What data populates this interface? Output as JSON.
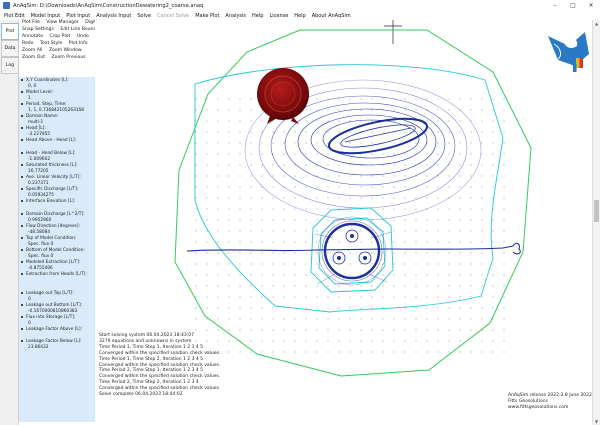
{
  "window": {
    "title": "AnAqSim: D:\\Downloads\\AnAqSim\\ConstructionDewatering2_coarse.anaq",
    "minimize": "–",
    "maximize": "□",
    "close": "✕"
  },
  "menu": [
    {
      "label": "Plot Edit",
      "enabled": true
    },
    {
      "label": "Model Input",
      "enabled": true
    },
    {
      "label": "Plot Input",
      "enabled": true
    },
    {
      "label": "Analysis Input",
      "enabled": true
    },
    {
      "label": "Solve",
      "enabled": true
    },
    {
      "label": "Cancel Solve",
      "enabled": false
    },
    {
      "label": "Make Plot",
      "enabled": true
    },
    {
      "label": "Analysis",
      "enabled": true
    },
    {
      "label": "Help",
      "enabled": true
    },
    {
      "label": "License",
      "enabled": true
    },
    {
      "label": "Help",
      "enabled": true
    },
    {
      "label": "About AnAqSim",
      "enabled": true
    }
  ],
  "side_tabs": {
    "plot": "Plot",
    "data": "Data",
    "log": "Log"
  },
  "commands": {
    "row1": [
      "Plot File",
      "View Manager",
      "Digitize"
    ],
    "row2": [
      "Snap Settings",
      "Edit Line Boundary"
    ],
    "row3": [
      "Annotate",
      "Crop Plot",
      "Undo"
    ],
    "row4": [
      "Redo",
      "Text Style",
      "Plot Info"
    ],
    "row5": [
      "Zoom All",
      "Zoom Window"
    ],
    "row6": [
      "Zoom Out",
      "Zoom Previous"
    ]
  },
  "properties": [
    {
      "label": "X,Y Coordinates [L]:",
      "value": "0, 0"
    },
    {
      "label": "Model Level:",
      "value": "1"
    },
    {
      "label": "Period, Step, Time:",
      "value": "1, 1, 0.736842105263158"
    },
    {
      "label": "Domain Name:",
      "value": "multi-1"
    },
    {
      "label": "Head [L]:",
      "value": "-3.227955"
    },
    {
      "label": "Head Above - Head [L]:",
      "value": ""
    },
    {
      "label": "Head - Head Below [L]:",
      "value": "-1.009602"
    },
    {
      "label": "Saturated thickness [L]:",
      "value": "16.77205"
    },
    {
      "label": "Ave. Linear Velocity [L/T]:",
      "value": "0.237371"
    },
    {
      "label": "Specific Discharge [L/T]:",
      "value": "0.05934275"
    },
    {
      "label": "Interface Elevation [L]:",
      "value": ""
    },
    {
      "label": "Domain Discharge [L^2/T]:",
      "value": "0.9952960"
    },
    {
      "label": "Flow Direction [degrees]:",
      "value": "-48.58084"
    },
    {
      "label": "Top of Model Condition:",
      "value": "Spec. flux 0"
    },
    {
      "label": "Bottom of Model Condition:",
      "value": "Spec. flux 0"
    },
    {
      "label": "Modeled Extraction [L/T]:",
      "value": "-0.8755406"
    },
    {
      "label": "Extraction from Heads [L/T]:",
      "value": ""
    },
    {
      "label": "Leakage out Top [L/T]:",
      "value": "0"
    },
    {
      "label": "Leakage out Bottom [L/T]:",
      "value": "-0.1670000810860383"
    },
    {
      "label": "Flux into Storage [L/T]:",
      "value": "0"
    },
    {
      "label": "Leakage Factor Above [L]:",
      "value": ""
    },
    {
      "label": "Leakage Factor Below [L]:",
      "value": "23.86432"
    }
  ],
  "log_lines": [
    "Start solving system 06.04.2023 18:43:07",
    "3279 equations and unknowns in system",
    "Time Period 1, Time Step 1, Iteration 1 2 3 4 5",
    "Converged within the specified solution check values.",
    "Time Period 1, Time Step 2, Iteration 1 2 3 4 5",
    "Converged within the specified solution check values.",
    "Time Period 2, Time Step 1, Iteration 1 2 3 4 5",
    "Converged within the specified solution check values.",
    "Time Period 2, Time Step 2, Iteration 1 2 3 4",
    "Converged within the specified solution check values.",
    "Solve complete 06.04.2023 18:44:02"
  ],
  "footer_lines": [
    "AnAqSim release 2022-2 8 June 2022",
    "Fitts Geosolutions",
    "www.fittsgeosolutions.com"
  ],
  "colors": {
    "far_field": "#33cc55",
    "inner_boundary": "#27c7d6",
    "contours": "#1f2fae",
    "wells": "#1a2f9b",
    "seal": "#8a1010",
    "side_panel": "#d9ebfb"
  },
  "icons": {
    "seal": "wax-seal-icon",
    "logo": "hands-and-dove-logo"
  }
}
